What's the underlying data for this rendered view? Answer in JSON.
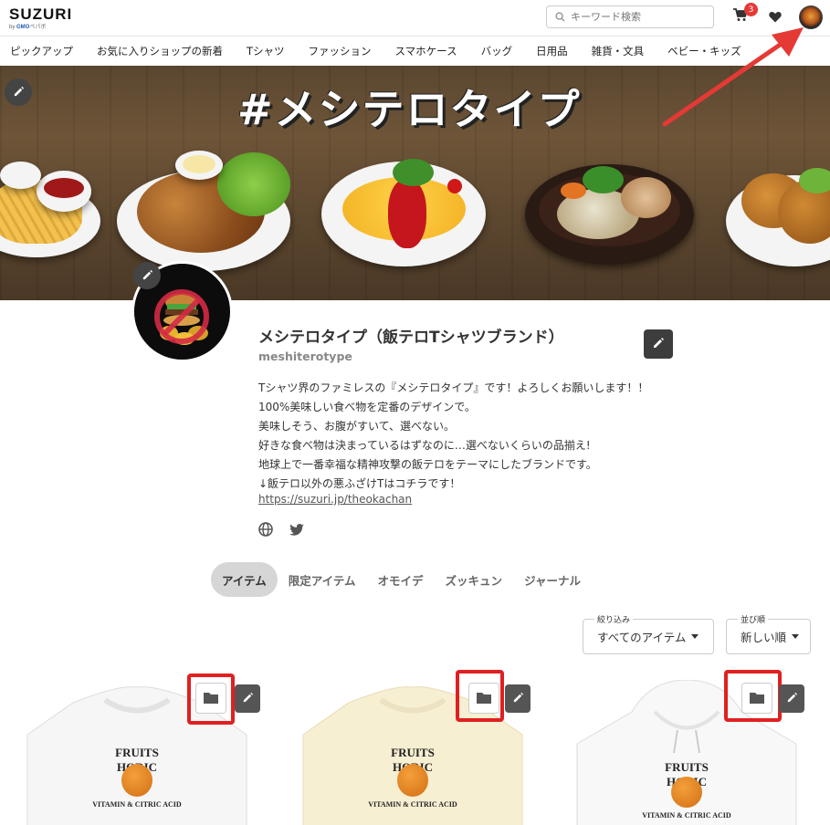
{
  "header": {
    "logo": "SUZURI",
    "logo_sub_prefix": "by ",
    "logo_sub_brand": "GMO",
    "logo_sub_suffix": "ペパボ",
    "search_placeholder": "キーワード検索",
    "cart_count": "3"
  },
  "nav": {
    "items": [
      "ピックアップ",
      "お気に入りショップの新着",
      "Tシャツ",
      "ファッション",
      "スマホケース",
      "バッグ",
      "日用品",
      "雑貨・文具",
      "ベビー・キッズ"
    ]
  },
  "banner": {
    "title": "#メシテロタイプ"
  },
  "profile": {
    "name": "メシテロタイプ（飯テロTシャツブランド）",
    "id": "meshiterotype",
    "description": [
      "Tシャツ界のファミレスの『メシテロタイプ』です！よろしくお願いします！！",
      "100%美味しい食べ物を定番のデザインで。",
      "美味しそう、お腹がすいて、選べない。",
      "好きな食べ物は決まっているはずなのに…選べないくらいの品揃え!",
      "地球上で一番幸福な精神攻撃の飯テロをテーマにしたブランドです。",
      "↓飯テロ以外の悪ふざけTはコチラです！"
    ],
    "link": "https://suzuri.jp/theokachan"
  },
  "tabs": [
    "アイテム",
    "限定アイテム",
    "オモイデ",
    "ズッキュン",
    "ジャーナル"
  ],
  "filters": {
    "narrow_label": "絞り込み",
    "narrow_value": "すべてのアイテム",
    "sort_label": "並び順",
    "sort_value": "新しい順"
  },
  "products": [
    {
      "line1": "FRUITS HORIC",
      "line2": "VITAMIN & CITRIC ACID"
    },
    {
      "line1": "FRUITS HORIC",
      "line2": "VITAMIN & CITRIC ACID"
    },
    {
      "line1": "FRUITS HORIC",
      "line2": "VITAMIN & CITRIC ACID"
    }
  ],
  "colors": {
    "highlight_red": "#e02020",
    "arrow_red": "#e53935",
    "tab_active_bg": "#d6d6d6"
  }
}
